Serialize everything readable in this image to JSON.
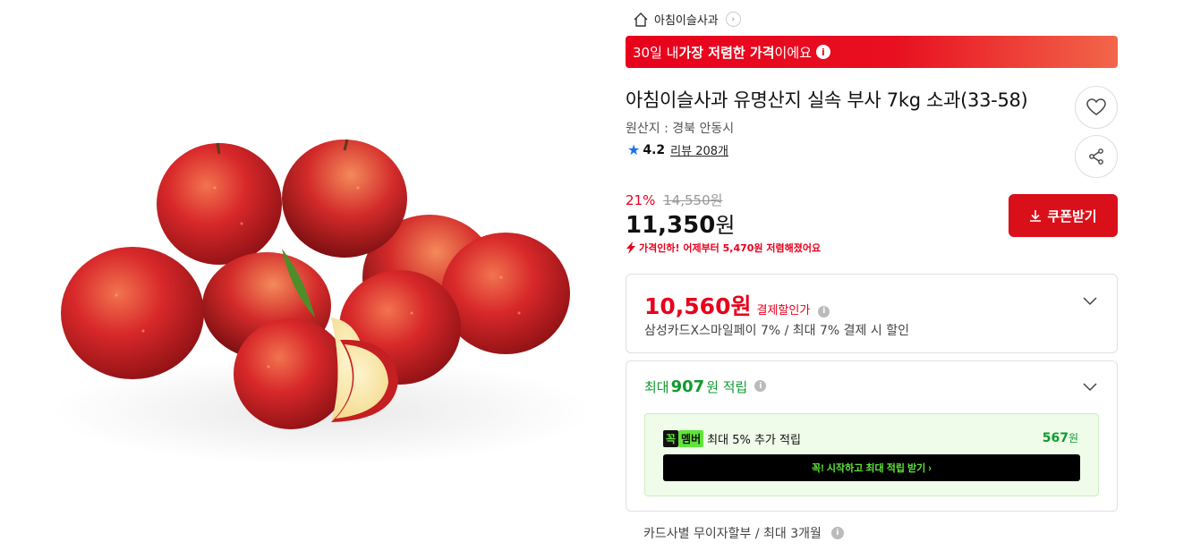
{
  "store": {
    "name": "아침이슬사과"
  },
  "banner": {
    "prefix": "30일 내 ",
    "highlight": "가장 저렴한 가격",
    "suffix": "이에요"
  },
  "product": {
    "title": "아침이슬사과 유명산지 실속 부사 7kg 소과(33-58)",
    "origin": "원산지 : 경북 안동시",
    "rating": "4.2",
    "reviews": "리뷰 208개"
  },
  "price": {
    "discount_rate": "21%",
    "original": "14,550원",
    "sale_number": "11,350",
    "sale_unit": "원",
    "drop_notice": "가격인하! 어제부터 5,470원 저렴해졌어요"
  },
  "coupon": {
    "label": "쿠폰받기"
  },
  "payment_discount": {
    "amount": "10,560원",
    "label": "결제할인가",
    "description": "삼성카드X스마일페이 7% / 최대 7% 결제 시 할인"
  },
  "points": {
    "prefix": "최대 ",
    "amount": "907",
    "suffix": "원 적립"
  },
  "member": {
    "badge_1": "꼭",
    "badge_2": "멤버",
    "text": "최대 5% 추가 적립",
    "amount_number": "567",
    "amount_unit": "원",
    "cta": "꼭! 시작하고 최대 적립 받기  ›"
  },
  "installment": {
    "text": "카드사별 무이자할부 / 최대 3개월"
  },
  "colors": {
    "brand_red": "#e8001c",
    "coupon_red": "#d9101a",
    "green": "#0f9a2e",
    "member_green": "#5ee43a",
    "star_blue": "#1a73e8"
  },
  "icons": {
    "home": "home-icon",
    "heart": "heart-icon",
    "share": "share-icon",
    "download": "download-icon",
    "chevron": "chevron-down-icon"
  }
}
